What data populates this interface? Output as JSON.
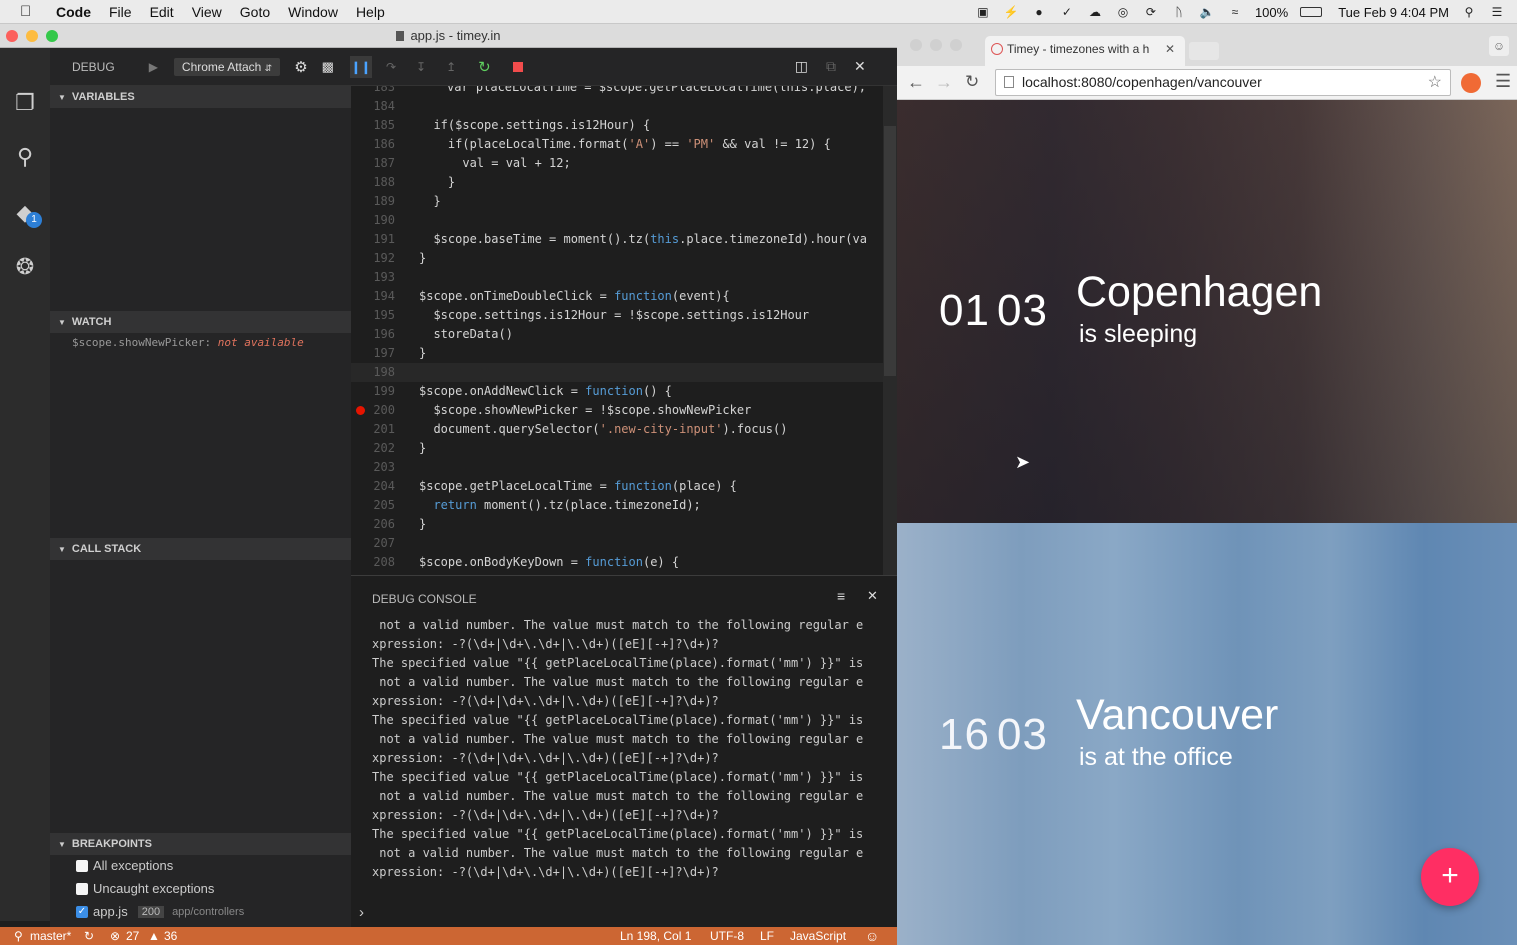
{
  "menubar": {
    "app": "Code",
    "items": [
      "File",
      "Edit",
      "View",
      "Goto",
      "Window",
      "Help"
    ],
    "battery": "100%",
    "datetime": "Tue Feb 9  4:04 PM"
  },
  "vscode": {
    "window_title": "app.js - timey.in",
    "debug_label": "DEBUG",
    "config_select": "Chrome Attach",
    "sections": {
      "variables": "VARIABLES",
      "watch": "WATCH",
      "call_stack": "CALL STACK",
      "breakpoints": "BREAKPOINTS"
    },
    "watch_expr": "$scope.showNewPicker:",
    "watch_value": "not available",
    "breakpoints": [
      {
        "label": "All exceptions",
        "checked": false
      },
      {
        "label": "Uncaught exceptions",
        "checked": false
      },
      {
        "label": "app.js",
        "checked": true,
        "line": "200",
        "path": "app/controllers"
      }
    ],
    "code_lines": [
      {
        "num": "184",
        "text": ""
      },
      {
        "num": "185",
        "text": "  if($scope.settings.is12Hour) {"
      },
      {
        "num": "186",
        "text": "    if(placeLocalTime.format('A') == 'PM' && val != 12) {"
      },
      {
        "num": "187",
        "text": "      val = val + 12;"
      },
      {
        "num": "188",
        "text": "    }"
      },
      {
        "num": "189",
        "text": "  }"
      },
      {
        "num": "190",
        "text": ""
      },
      {
        "num": "191",
        "text": "  $scope.baseTime = moment().tz(this.place.timezoneId).hour(va"
      },
      {
        "num": "192",
        "text": "}"
      },
      {
        "num": "193",
        "text": ""
      },
      {
        "num": "194",
        "text": "$scope.onTimeDoubleClick = function(event){"
      },
      {
        "num": "195",
        "text": "  $scope.settings.is12Hour = !$scope.settings.is12Hour"
      },
      {
        "num": "196",
        "text": "  storeData()"
      },
      {
        "num": "197",
        "text": "}"
      },
      {
        "num": "198",
        "text": ""
      },
      {
        "num": "199",
        "text": "$scope.onAddNewClick = function() {"
      },
      {
        "num": "200",
        "text": "  $scope.showNewPicker = !$scope.showNewPicker"
      },
      {
        "num": "201",
        "text": "  document.querySelector('.new-city-input').focus()"
      },
      {
        "num": "202",
        "text": "}"
      },
      {
        "num": "203",
        "text": ""
      },
      {
        "num": "204",
        "text": "$scope.getPlaceLocalTime = function(place) {"
      },
      {
        "num": "205",
        "text": "  return moment().tz(place.timezoneId);"
      },
      {
        "num": "206",
        "text": "}"
      },
      {
        "num": "207",
        "text": ""
      },
      {
        "num": "208",
        "text": "$scope.onBodyKeyDown = function(e) {"
      }
    ],
    "top_partial_line": "var placeLocalTime = $scope.getPlaceLocalTime(this.place);",
    "console_title": "DEBUG CONSOLE",
    "console_lines": [
      " not a valid number. The value must match to the following regular e",
      "xpression: -?(\\d+|\\d+\\.\\d+|\\.\\d+)([eE][-+]?\\d+)?",
      "The specified value \"{{ getPlaceLocalTime(place).format('mm') }}\" is",
      " not a valid number. The value must match to the following regular e",
      "xpression: -?(\\d+|\\d+\\.\\d+|\\.\\d+)([eE][-+]?\\d+)?",
      "The specified value \"{{ getPlaceLocalTime(place).format('mm') }}\" is",
      " not a valid number. The value must match to the following regular e",
      "xpression: -?(\\d+|\\d+\\.\\d+|\\.\\d+)([eE][-+]?\\d+)?",
      "The specified value \"{{ getPlaceLocalTime(place).format('mm') }}\" is",
      " not a valid number. The value must match to the following regular e",
      "xpression: -?(\\d+|\\d+\\.\\d+|\\.\\d+)([eE][-+]?\\d+)?",
      "The specified value \"{{ getPlaceLocalTime(place).format('mm') }}\" is",
      " not a valid number. The value must match to the following regular e",
      "xpression: -?(\\d+|\\d+\\.\\d+|\\.\\d+)([eE][-+]?\\d+)?"
    ],
    "console_prompt": "›",
    "status": {
      "branch": "master*",
      "errors": "27",
      "warnings": "36",
      "position": "Ln 198, Col 1",
      "encoding": "UTF-8",
      "eol": "LF",
      "language": "JavaScript"
    },
    "badge_count": "1"
  },
  "chrome": {
    "tab_title": "Timey - timezones with a h",
    "url": "localhost:8080/copenhagen/vancouver"
  },
  "timey": {
    "cities": [
      {
        "hours": "01",
        "minutes": "03",
        "name": "Copenhagen",
        "status": "is sleeping"
      },
      {
        "hours": "16",
        "minutes": "03",
        "name": "Vancouver",
        "status": "is at the office"
      }
    ],
    "add_label": "+"
  }
}
